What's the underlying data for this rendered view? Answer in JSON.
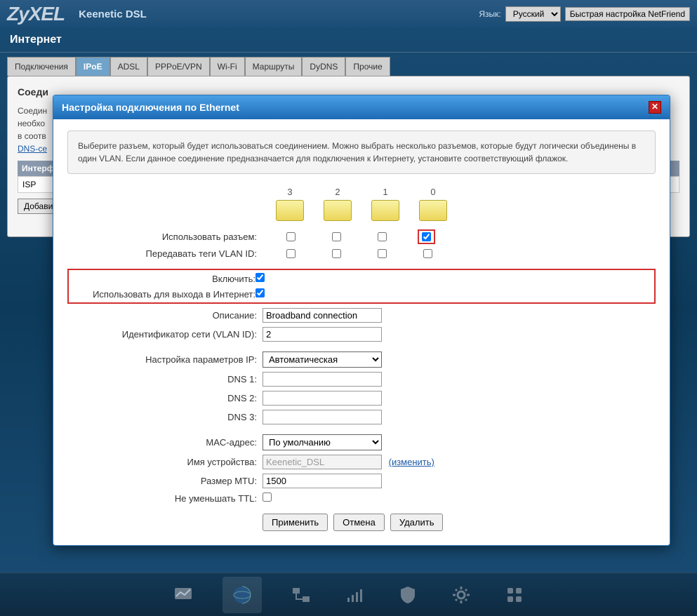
{
  "header": {
    "logo": "ZyXEL",
    "product": "Keenetic DSL",
    "lang_label": "Язык:",
    "lang_value": "Русский",
    "netfriend": "Быстрая настройка NetFriend"
  },
  "section": "Интернет",
  "tabs": [
    "Подключения",
    "IPoE",
    "ADSL",
    "PPPoE/VPN",
    "Wi-Fi",
    "Маршруты",
    "DyDNS",
    "Прочие"
  ],
  "active_tab": 1,
  "bg_panel": {
    "heading": "Соеди",
    "hint1": "Соедин",
    "hint2": "необхо",
    "hint3": "в соотв",
    "dns_link": "DNS-се",
    "col_head": "Интерф",
    "row1": "ISP",
    "add_btn": "Добави"
  },
  "modal": {
    "title": "Настройка подключения по Ethernet",
    "info": "Выберите разъем, который будет использоваться соединением. Можно выбрать несколько разъемов, которые будут логически объединены в один VLAN. Если данное соединение предназначается для подключения к Интернету, установите соответствующий флажок.",
    "ports": [
      "3",
      "2",
      "1",
      "0"
    ],
    "labels": {
      "use_port": "Использовать разъем:",
      "vlan_tags": "Передавать теги VLAN ID:",
      "enable": "Включить:",
      "use_internet": "Использовать для выхода в Интернет:",
      "description": "Описание:",
      "vlan_id": "Идентификатор сети (VLAN ID):",
      "ip_config": "Настройка параметров IP:",
      "dns1": "DNS 1:",
      "dns2": "DNS 2:",
      "dns3": "DNS 3:",
      "mac": "MAC-адрес:",
      "device_name": "Имя устройства:",
      "mtu": "Размер MTU:",
      "ttl": "Не уменьшать TTL:"
    },
    "values": {
      "description": "Broadband connection",
      "vlan_id": "2",
      "ip_config": "Автоматическая",
      "dns1": "",
      "dns2": "",
      "dns3": "",
      "mac": "По умолчанию",
      "device_name": "Keenetic_DSL",
      "mtu": "1500"
    },
    "change_link": "(изменить)",
    "buttons": {
      "apply": "Применить",
      "cancel": "Отмена",
      "delete": "Удалить"
    }
  },
  "dock": [
    "monitor",
    "globe",
    "network",
    "wifi",
    "firewall",
    "settings",
    "apps"
  ]
}
